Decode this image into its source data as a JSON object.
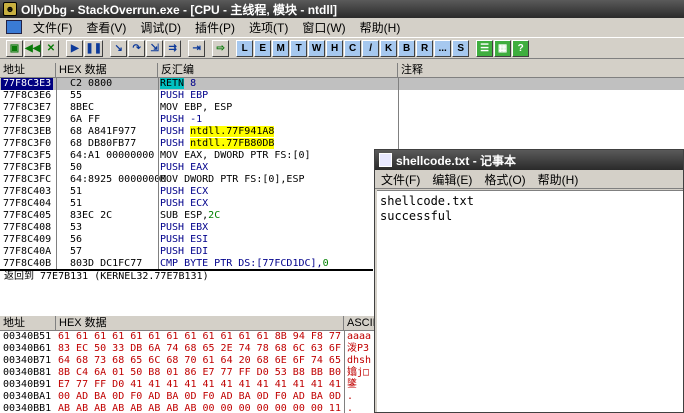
{
  "window": {
    "title": "OllyDbg - StackOverrun.exe - [CPU - 主线程, 模块 - ntdll]",
    "icon": "ollydbg-app-icon"
  },
  "menu": [
    "文件(F)",
    "查看(V)",
    "调试(D)",
    "插件(P)",
    "选项(T)",
    "窗口(W)",
    "帮助(H)"
  ],
  "toolbar": {
    "icons": [
      "open-icon",
      "restart-icon",
      "close-icon",
      "run-icon",
      "pause-icon",
      "step-into-icon",
      "step-over-icon",
      "trace-into-icon",
      "trace-over-icon",
      "execute-till-return-icon",
      "goto-icon"
    ],
    "letters": [
      "L",
      "E",
      "M",
      "T",
      "W",
      "H",
      "C",
      "/",
      "K",
      "B",
      "R",
      "...",
      "S"
    ],
    "extra_icons": [
      "list-icon",
      "grid-icon",
      "help-icon"
    ]
  },
  "disasm": {
    "headers": {
      "addr": "地址",
      "hex": "HEX 数据",
      "dis": "反汇编",
      "comment": "注释"
    },
    "rows": [
      {
        "addr": "77F8C3E3",
        "hex": "C2 0800",
        "op": "RETN",
        "arg": " 8",
        "style": "retn",
        "selected": true
      },
      {
        "addr": "77F8C3E6",
        "hex": "55",
        "op": "PUSH",
        "arg": " EBP",
        "style": "kw"
      },
      {
        "addr": "77F8C3E7",
        "hex": "8BEC",
        "op": "MOV",
        "arg": " EBP, ESP",
        "style": "plain"
      },
      {
        "addr": "77F8C3E9",
        "hex": "6A FF",
        "op": "PUSH",
        "arg": " -1",
        "style": "kw"
      },
      {
        "addr": "77F8C3EB",
        "hex": "68 A841F977",
        "op": "PUSH",
        "arg": "ntdll.77F941A8",
        "style": "sym"
      },
      {
        "addr": "77F8C3F0",
        "hex": "68 DB80FB77",
        "op": "PUSH",
        "arg": "ntdll.77FB80DB",
        "style": "sym"
      },
      {
        "addr": "77F8C3F5",
        "hex": "64:A1 00000000",
        "op": "MOV",
        "arg": " EAX, DWORD PTR FS:[0]",
        "style": "plain"
      },
      {
        "addr": "77F8C3FB",
        "hex": "50",
        "op": "PUSH",
        "arg": " EAX",
        "style": "kw"
      },
      {
        "addr": "77F8C3FC",
        "hex": "64:8925 00000000",
        "op": "MOV",
        "arg": " DWORD PTR FS:[0],ESP",
        "style": "plain"
      },
      {
        "addr": "77F8C403",
        "hex": "51",
        "op": "PUSH",
        "arg": " ECX",
        "style": "kw"
      },
      {
        "addr": "77F8C404",
        "hex": "51",
        "op": "PUSH",
        "arg": " ECX",
        "style": "kw"
      },
      {
        "addr": "77F8C405",
        "hex": "83EC 2C",
        "op": "SUB",
        "arg": " ESP,",
        "imm": "2C",
        "style": "plain"
      },
      {
        "addr": "77F8C408",
        "hex": "53",
        "op": "PUSH",
        "arg": " EBX",
        "style": "kw"
      },
      {
        "addr": "77F8C409",
        "hex": "56",
        "op": "PUSH",
        "arg": " ESI",
        "style": "kw"
      },
      {
        "addr": "77F8C40A",
        "hex": "57",
        "op": "PUSH",
        "arg": " EDI",
        "style": "kw"
      },
      {
        "addr": "77F8C40B",
        "hex": "803D DC1FC77",
        "op": "CMP",
        "arg": " BYTE PTR DS:[77FCD1DC],",
        "imm": "0",
        "style": "kw"
      }
    ]
  },
  "status": "返回到 77E7B131 (KERNEL32.77E7B131)",
  "dump": {
    "headers": {
      "addr": "地址",
      "hex": "HEX 数据",
      "ascii": "ASCII"
    },
    "rows": [
      {
        "addr": "00340B51",
        "hex": "61 61 61 61 61 61 61 61 61 61 61 61 8B 94 F8 77",
        "ascii": "aaaa"
      },
      {
        "addr": "00340B61",
        "hex": "83 EC 50 33 DB 6A 74 68 65 2E 74 78 68 6C 63 6F",
        "ascii": "泼P3"
      },
      {
        "addr": "00340B71",
        "hex": "64 68 73 68 65 6C 68 70 61 64 20 68 6E 6F 74 65",
        "ascii": "dhsh"
      },
      {
        "addr": "00340B81",
        "hex": "8B C4 6A 01 50 B8 01 86 E7 77 FF D0 53 B8 BB B0",
        "ascii": "嬆j□"
      },
      {
        "addr": "00340B91",
        "hex": "E7 77 FF D0 41 41 41 41 41 41 41 41 41 41 41 41",
        "ascii": "鐆"
      },
      {
        "addr": "00340BA1",
        "hex": "00 AD BA 0D F0 AD BA 0D F0 AD BA 0D F0 AD BA 0D",
        "ascii": "."
      },
      {
        "addr": "00340BB1",
        "hex": "AB AB AB AB AB AB AB AB 00 00 00 00 00 00 00 11",
        "ascii": "."
      }
    ]
  },
  "notepad": {
    "title": "shellcode.txt - 记事本",
    "menu": [
      "文件(F)",
      "编辑(E)",
      "格式(O)",
      "帮助(H)"
    ],
    "lines": [
      "shellcode.txt",
      "successful"
    ]
  }
}
